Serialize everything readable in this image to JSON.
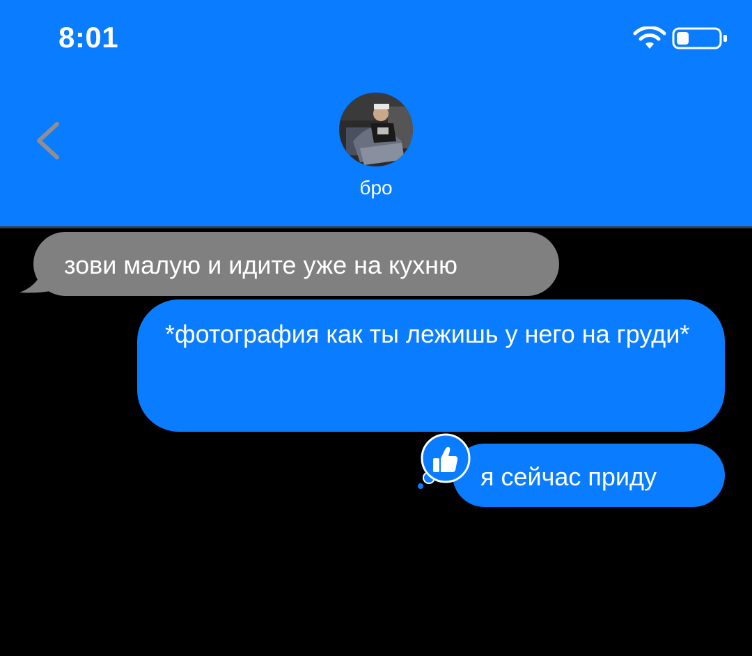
{
  "status_bar": {
    "time": "8:01",
    "wifi_icon": "wifi-icon",
    "battery_icon": "battery-icon",
    "battery_level": 0.3
  },
  "header": {
    "background": "#0A7CFF",
    "back_icon": "chevron-left-icon",
    "contact_name": "бро",
    "avatar_icon": "contact-avatar"
  },
  "messages": [
    {
      "direction": "incoming",
      "text": "зови малую и идите уже на кухню",
      "bubble_color": "#808080"
    },
    {
      "direction": "outgoing",
      "text": "*фотография как ты лежишь у него на груди*",
      "bubble_color": "#0A7CFF"
    },
    {
      "direction": "outgoing",
      "text": "я сейчас приду",
      "bubble_color": "#0A7CFF",
      "reaction": "thumbs-up-icon"
    }
  ]
}
